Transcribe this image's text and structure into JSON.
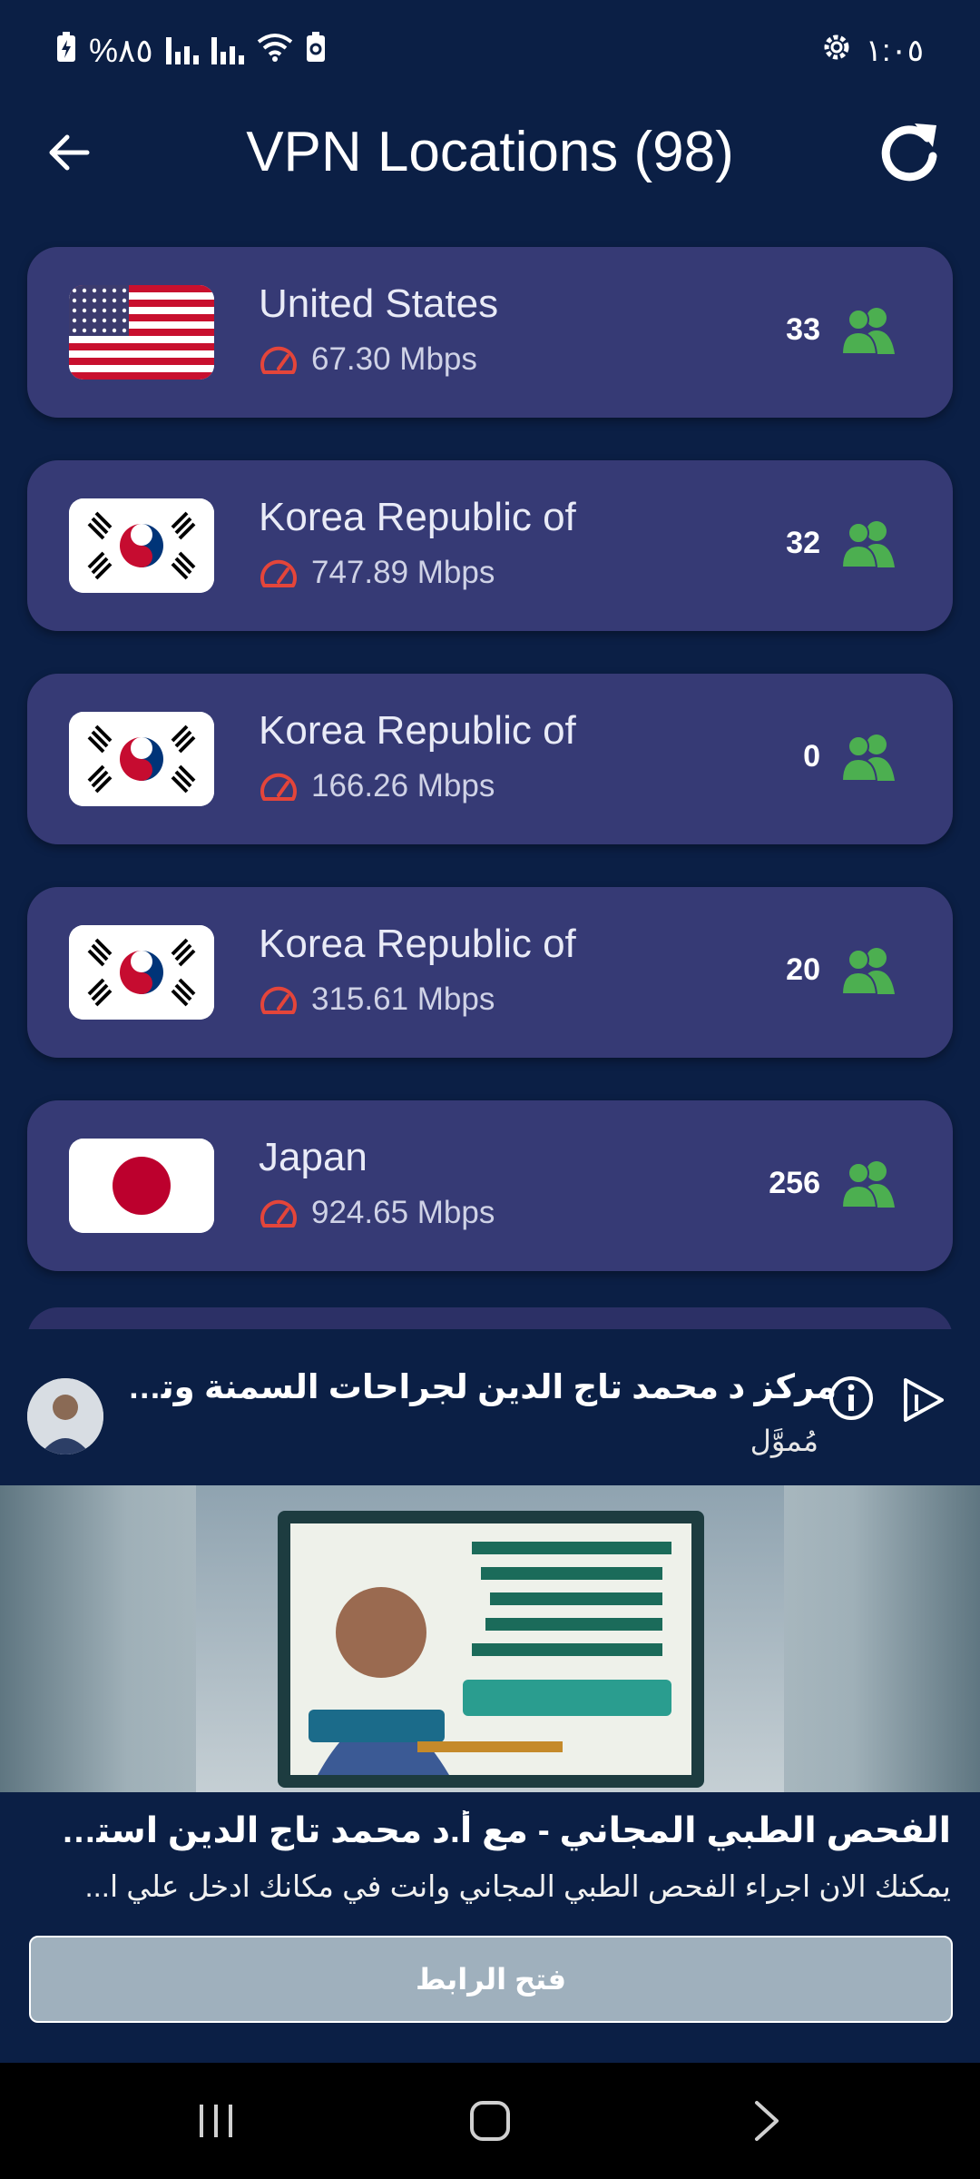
{
  "status_bar": {
    "battery_percent": "%٨٥",
    "time": "١:٠٥"
  },
  "app_bar": {
    "title": "VPN Locations (98)",
    "back_icon": "arrow-left-icon",
    "refresh_icon": "refresh-icon"
  },
  "locations": [
    {
      "country": "United States",
      "speed": "67.30 Mbps",
      "users": "33",
      "flag": "us"
    },
    {
      "country": "Korea Republic of",
      "speed": "747.89 Mbps",
      "users": "32",
      "flag": "kr"
    },
    {
      "country": "Korea Republic of",
      "speed": "166.26 Mbps",
      "users": "0",
      "flag": "kr"
    },
    {
      "country": "Korea Republic of",
      "speed": "315.61 Mbps",
      "users": "20",
      "flag": "kr"
    },
    {
      "country": "Japan",
      "speed": "924.65 Mbps",
      "users": "256",
      "flag": "jp"
    }
  ],
  "ad": {
    "advertiser": "مركز د محمد تاج الدين لجراحات السمنة وتن...",
    "sponsored": "مُموَّل",
    "headline": "الفحص الطبي المجاني - مع أ.د محمد تاج الدين استشاري ...",
    "description": "يمكنك الان اجراء الفحص الطبي المجاني وانت في مكانك  ادخل علي ا...",
    "cta": "فتح الرابط"
  },
  "colors": {
    "background": "#0b1f45",
    "card": "#363a75",
    "speed_icon": "#e4453a",
    "users_icon": "#4caf50"
  }
}
